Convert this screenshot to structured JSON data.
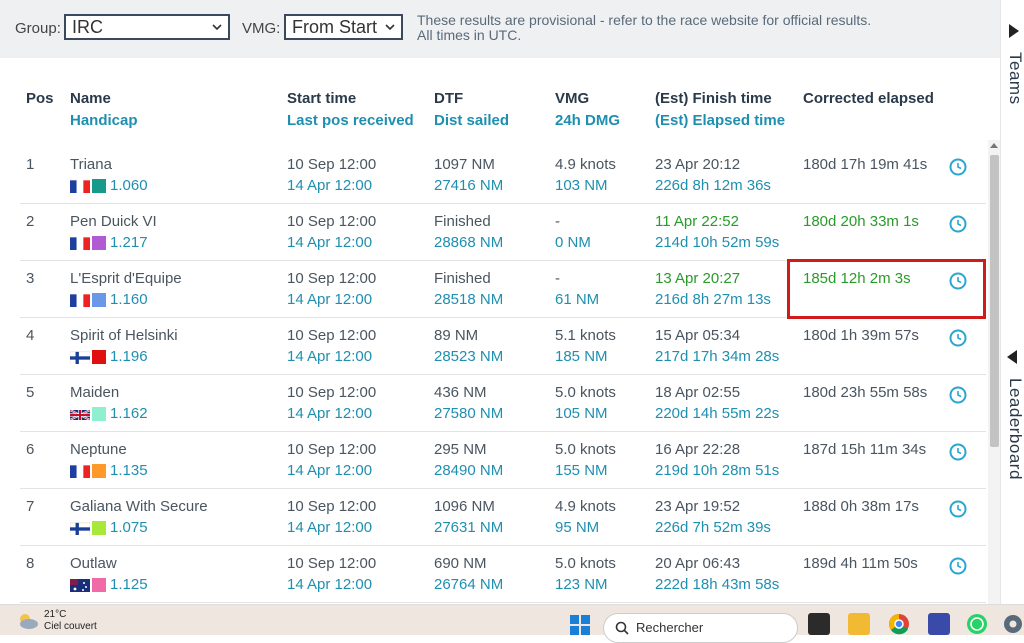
{
  "filters": {
    "group_label": "Group:",
    "group_value": "IRC",
    "vmg_label": "VMG:",
    "vmg_value": "From Start",
    "note_line1": "These results are provisional - refer to the race website for official results.",
    "note_line2": "All times in UTC."
  },
  "side_panel": {
    "teams": "Teams",
    "leaderboard": "Leaderboard"
  },
  "columns": {
    "pos": "Pos",
    "name": "Name",
    "handicap": "Handicap",
    "start": "Start time",
    "lastpos": "Last pos received",
    "dtf": "DTF",
    "dist": "Dist sailed",
    "vmg": "VMG",
    "dmg": "24h DMG",
    "finish": "(Est) Finish time",
    "elapsed": "(Est) Elapsed time",
    "corrected": "Corrected elapsed"
  },
  "rows": [
    {
      "pos": "1",
      "name": "Triana",
      "flag": "FR",
      "color": "#179a8a",
      "handicap": "1.060",
      "start": "10 Sep 12:00",
      "lastpos": "14 Apr 12:00",
      "dtf": "1097 NM",
      "dist": "27416 NM",
      "vmg": "4.9 knots",
      "dmg": "103 NM",
      "finish": "23 Apr 20:12",
      "elapsed": "226d 8h 12m 36s",
      "corrected": "180d 17h 19m 41s",
      "finished": false
    },
    {
      "pos": "2",
      "name": "Pen Duick VI",
      "flag": "FR",
      "color": "#b05ad6",
      "handicap": "1.217",
      "start": "10 Sep 12:00",
      "lastpos": "14 Apr 12:00",
      "dtf": "Finished",
      "dist": "28868 NM",
      "vmg": "-",
      "dmg": "0 NM",
      "finish": "11 Apr 22:52",
      "elapsed": "214d 10h 52m 59s",
      "corrected": "180d 20h 33m 1s",
      "finished": true
    },
    {
      "pos": "3",
      "name": "L'Esprit d'Equipe",
      "flag": "FR",
      "color": "#6a98e8",
      "handicap": "1.160",
      "start": "10 Sep 12:00",
      "lastpos": "14 Apr 12:00",
      "dtf": "Finished",
      "dist": "28518 NM",
      "vmg": "-",
      "dmg": "61 NM",
      "finish": "13 Apr 20:27",
      "elapsed": "216d 8h 27m 13s",
      "corrected": "185d 12h 2m 3s",
      "finished": true
    },
    {
      "pos": "4",
      "name": "Spirit of Helsinki",
      "flag": "FI",
      "color": "#e01010",
      "handicap": "1.196",
      "start": "10 Sep 12:00",
      "lastpos": "14 Apr 12:00",
      "dtf": "89 NM",
      "dist": "28523 NM",
      "vmg": "5.1 knots",
      "dmg": "185 NM",
      "finish": "15 Apr 05:34",
      "elapsed": "217d 17h 34m 28s",
      "corrected": "180d 1h 39m 57s",
      "finished": false
    },
    {
      "pos": "5",
      "name": "Maiden",
      "flag": "GB",
      "color": "#8ef0d0",
      "handicap": "1.162",
      "start": "10 Sep 12:00",
      "lastpos": "14 Apr 12:00",
      "dtf": "436 NM",
      "dist": "27580 NM",
      "vmg": "5.0 knots",
      "dmg": "105 NM",
      "finish": "18 Apr 02:55",
      "elapsed": "220d 14h 55m 22s",
      "corrected": "180d 23h 55m 58s",
      "finished": false
    },
    {
      "pos": "6",
      "name": "Neptune",
      "flag": "FR",
      "color": "#ff9a2a",
      "handicap": "1.135",
      "start": "10 Sep 12:00",
      "lastpos": "14 Apr 12:00",
      "dtf": "295 NM",
      "dist": "28490 NM",
      "vmg": "5.0 knots",
      "dmg": "155 NM",
      "finish": "16 Apr 22:28",
      "elapsed": "219d 10h 28m 51s",
      "corrected": "187d 15h 11m 34s",
      "finished": false
    },
    {
      "pos": "7",
      "name": "Galiana With Secure",
      "flag": "FI",
      "color": "#a8e83a",
      "handicap": "1.075",
      "start": "10 Sep 12:00",
      "lastpos": "14 Apr 12:00",
      "dtf": "1096 NM",
      "dist": "27631 NM",
      "vmg": "4.9 knots",
      "dmg": "95 NM",
      "finish": "23 Apr 19:52",
      "elapsed": "226d 7h 52m 39s",
      "corrected": "188d 0h 38m 17s",
      "finished": false
    },
    {
      "pos": "8",
      "name": "Outlaw",
      "flag": "AU",
      "color": "#f06aa8",
      "handicap": "1.125",
      "start": "10 Sep 12:00",
      "lastpos": "14 Apr 12:00",
      "dtf": "690 NM",
      "dist": "26764 NM",
      "vmg": "5.0 knots",
      "dmg": "123 NM",
      "finish": "20 Apr 06:43",
      "elapsed": "222d 18h 43m 58s",
      "corrected": "189d 4h 11m 50s",
      "finished": false
    }
  ],
  "taskbar": {
    "temp": "21°C",
    "weather": "Ciel couvert",
    "search": "Rechercher"
  }
}
